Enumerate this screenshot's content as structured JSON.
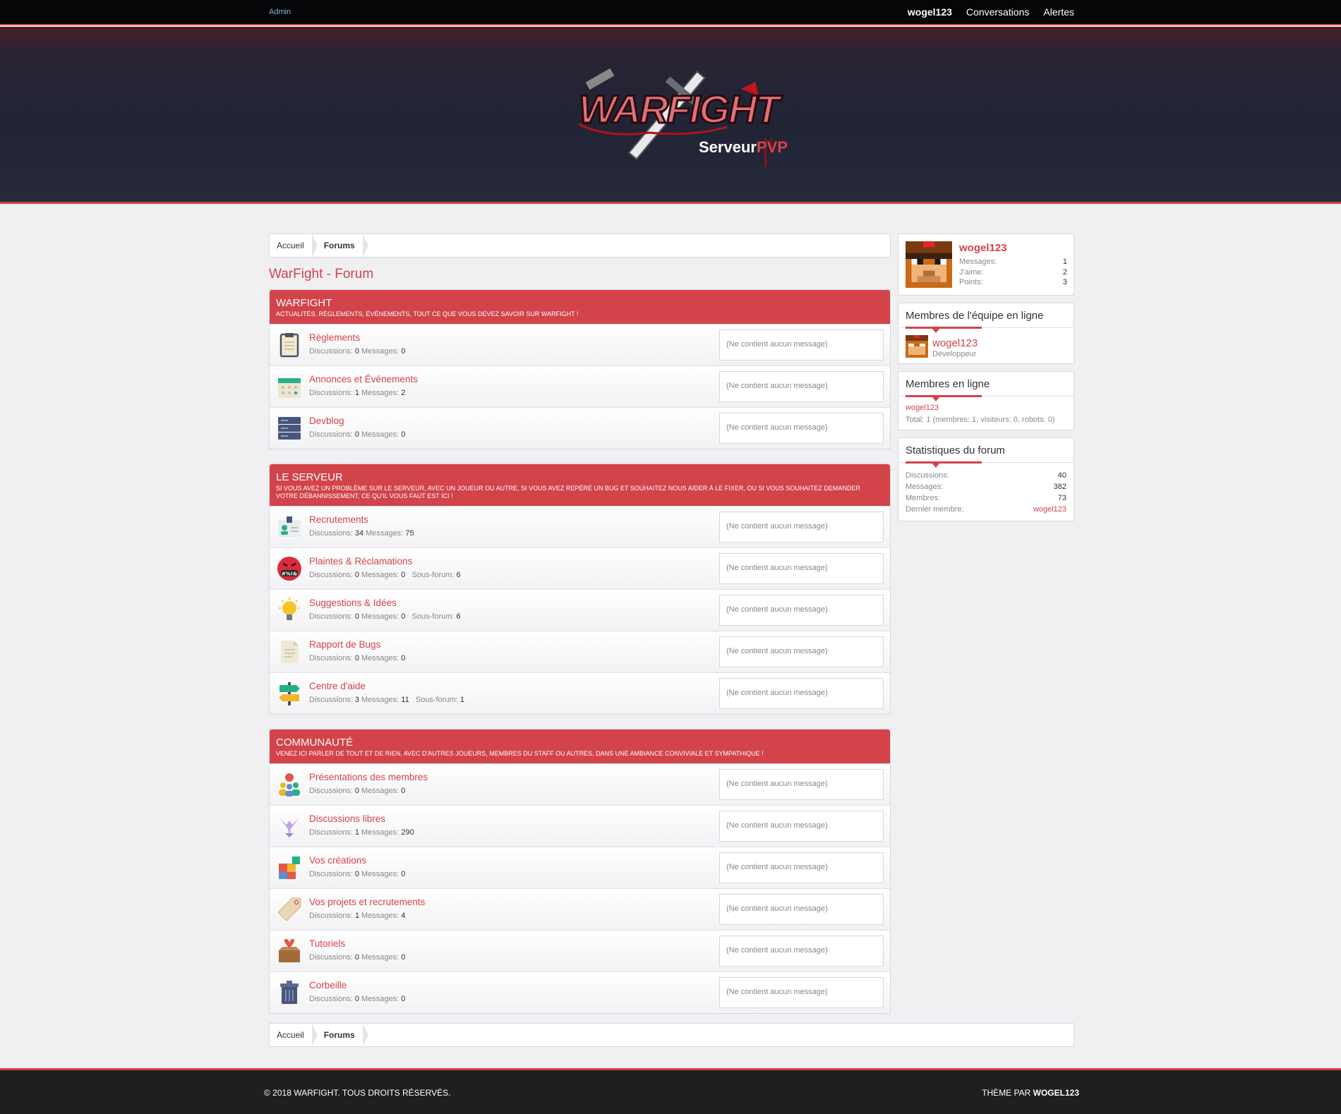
{
  "topbar": {
    "admin": "Admin",
    "user": "wogel123",
    "conversations": "Conversations",
    "alerts": "Alertes"
  },
  "logo": {
    "main": "WARFIGHT",
    "sub_a": "Serveur",
    "sub_b": "PVP"
  },
  "breadcrumb": {
    "home": "Accueil",
    "forums": "Forums"
  },
  "page_title": "WarFight - Forum",
  "labels": {
    "discussions": "Discussions:",
    "messages": "Messages:",
    "subforum": "Sous-forum:",
    "empty": "(Ne contient aucun message)"
  },
  "categories": [
    {
      "title": "WARFIGHT",
      "desc": "Actualités, règlements, événements, tout ce que vous devez savoir sur WarFight !",
      "nodes": [
        {
          "title": "Règlements",
          "discussions": "0",
          "messages": "0",
          "icon": "clipboard-icon"
        },
        {
          "title": "Annonces et Événements",
          "discussions": "1",
          "messages": "2",
          "icon": "calendar-icon"
        },
        {
          "title": "Devblog",
          "discussions": "0",
          "messages": "0",
          "icon": "server-icon"
        }
      ]
    },
    {
      "title": "LE SERVEUR",
      "desc": "Si vous avez un problème sur le serveur, avec un joueur ou autre, si vous avez repéré un bug et souhaitez nous aider à le fixer, ou si vous souhaitez demander votre débannissement, ce qu'il vous faut est ici !",
      "nodes": [
        {
          "title": "Recrutements",
          "discussions": "34",
          "messages": "75",
          "icon": "id-card-icon"
        },
        {
          "title": "Plaintes & Réclamations",
          "discussions": "0",
          "messages": "0",
          "subforum": "6",
          "icon": "angry-face-icon"
        },
        {
          "title": "Suggestions & Idées",
          "discussions": "0",
          "messages": "0",
          "subforum": "6",
          "icon": "lightbulb-icon"
        },
        {
          "title": "Rapport de Bugs",
          "discussions": "0",
          "messages": "0",
          "icon": "document-icon"
        },
        {
          "title": "Centre d'aide",
          "discussions": "3",
          "messages": "11",
          "subforum": "1",
          "icon": "signpost-icon"
        }
      ]
    },
    {
      "title": "COMMUNAUTÉ",
      "desc": "Venez ici parler de tout et de rien, avec d'autres joueurs, membres du staff ou autres, dans une ambiance conviviale et sympathique !",
      "nodes": [
        {
          "title": "Présentations des membres",
          "discussions": "0",
          "messages": "0",
          "icon": "people-chat-icon"
        },
        {
          "title": "Discussions libres",
          "discussions": "1",
          "messages": "290",
          "icon": "bird-icon"
        },
        {
          "title": "Vos créations",
          "discussions": "0",
          "messages": "0",
          "icon": "puzzle-icon"
        },
        {
          "title": "Vos projets et recrutements",
          "discussions": "1",
          "messages": "4",
          "icon": "tag-icon"
        },
        {
          "title": "Tutoriels",
          "discussions": "0",
          "messages": "0",
          "icon": "gift-box-icon"
        },
        {
          "title": "Corbeille",
          "discussions": "0",
          "messages": "0",
          "icon": "trash-icon"
        }
      ]
    }
  ],
  "sidebar": {
    "visitor": {
      "name": "wogel123",
      "messages_label": "Messages:",
      "messages": "1",
      "likes_label": "J'aime:",
      "likes": "2",
      "points_label": "Points:",
      "points": "3"
    },
    "staff": {
      "title": "Membres de l'équipe en ligne",
      "name": "wogel123",
      "role": "Développeur"
    },
    "online": {
      "title": "Membres en ligne",
      "user": "wogel123",
      "total": "Total: 1 (membres: 1, visiteurs: 0, robots: 0)"
    },
    "stats": {
      "title": "Statistiques du forum",
      "discussions_label": "Discussions:",
      "discussions": "40",
      "messages_label": "Messages:",
      "messages": "382",
      "members_label": "Membres:",
      "members": "73",
      "latest_label": "Dernier membre:",
      "latest": "wogel123"
    }
  },
  "footer": {
    "copyright": "© 2018 WARFIGHT. TOUS DROITS RÉSERVÉS.",
    "theme_prefix": "THÈME PAR ",
    "theme_author": "WOGEL123"
  },
  "colors": {
    "accent": "#d3434a",
    "topbar": "#060608",
    "footer": "#1f1f22"
  }
}
